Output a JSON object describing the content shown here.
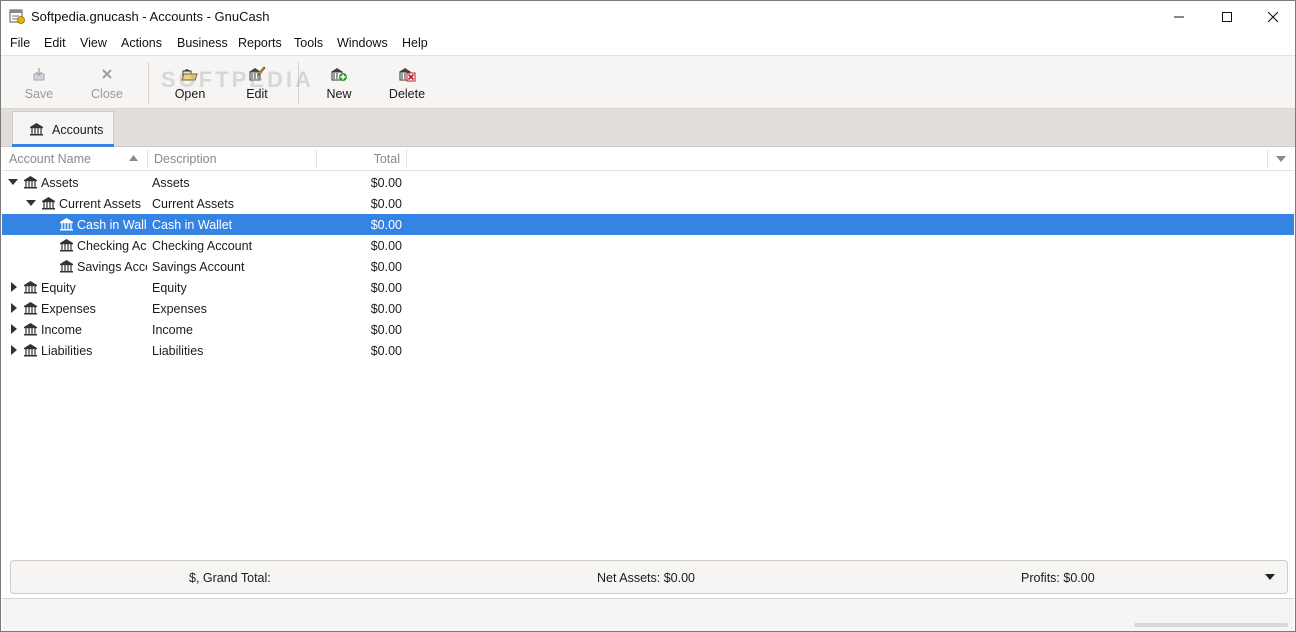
{
  "window": {
    "title": "Softpedia.gnucash - Accounts - GnuCash",
    "icon": "gnucash-app-icon"
  },
  "menu": [
    "File",
    "Edit",
    "View",
    "Actions",
    "Business",
    "Reports",
    "Tools",
    "Windows",
    "Help"
  ],
  "toolbar": {
    "save": {
      "label": "Save",
      "icon": "save-icon",
      "enabled": false
    },
    "close": {
      "label": "Close",
      "icon": "close-icon",
      "enabled": false
    },
    "open": {
      "label": "Open",
      "icon": "open-account-icon",
      "enabled": true
    },
    "edit": {
      "label": "Edit",
      "icon": "edit-account-icon",
      "enabled": true
    },
    "new": {
      "label": "New",
      "icon": "new-account-icon",
      "enabled": true
    },
    "delete": {
      "label": "Delete",
      "icon": "delete-account-icon",
      "enabled": true
    }
  },
  "watermark": "SOFTPEDIA",
  "tabs": [
    {
      "label": "Accounts",
      "icon": "bank-icon",
      "active": true
    }
  ],
  "columns": {
    "name": "Account Name",
    "description": "Description",
    "total": "Total"
  },
  "accounts": [
    {
      "name": "Assets",
      "description": "Assets",
      "total": "$0.00",
      "expander": "expanded"
    },
    {
      "name": "Current Assets",
      "description": "Current Assets",
      "total": "$0.00",
      "expander": "expanded"
    },
    {
      "name": "Cash in Wallet",
      "description": "Cash in Wallet",
      "total": "$0.00",
      "expander": "none",
      "selected": true
    },
    {
      "name": "Checking Account",
      "description": "Checking Account",
      "total": "$0.00",
      "expander": "none"
    },
    {
      "name": "Savings Account",
      "description": "Savings Account",
      "total": "$0.00",
      "expander": "none"
    },
    {
      "name": "Equity",
      "description": "Equity",
      "total": "$0.00",
      "expander": "collapsed"
    },
    {
      "name": "Expenses",
      "description": "Expenses",
      "total": "$0.00",
      "expander": "collapsed"
    },
    {
      "name": "Income",
      "description": "Income",
      "total": "$0.00",
      "expander": "collapsed"
    },
    {
      "name": "Liabilities",
      "description": "Liabilities",
      "total": "$0.00",
      "expander": "collapsed"
    }
  ],
  "summary": {
    "grand_total": "$, Grand Total:",
    "net_assets": "Net Assets: $0.00",
    "profits": "Profits: $0.00"
  },
  "colors": {
    "selection": "#3584e4",
    "toolbar_bg": "#f6f5f4",
    "tabstrip_bg": "#e1ded9"
  }
}
